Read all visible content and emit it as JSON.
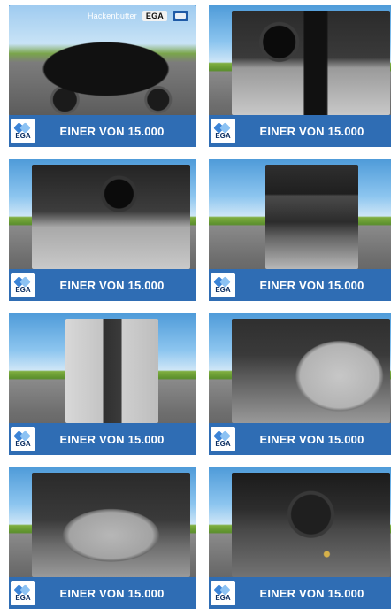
{
  "dealer": {
    "name": "Hackenbutter",
    "brand": "EGA"
  },
  "tiles": [
    {
      "caption": "EINER VON 15.000",
      "logo_text": "EGA",
      "photo": "exterior"
    },
    {
      "caption": "EINER VON 15.000",
      "logo_text": "EGA",
      "photo": "dashboard"
    },
    {
      "caption": "EINER VON 15.000",
      "logo_text": "EGA",
      "photo": "steering-side"
    },
    {
      "caption": "EINER VON 15.000",
      "logo_text": "EGA",
      "photo": "center-console"
    },
    {
      "caption": "EINER VON 15.000",
      "logo_text": "EGA",
      "photo": "door-panel"
    },
    {
      "caption": "EINER VON 15.000",
      "logo_text": "EGA",
      "photo": "front-seat"
    },
    {
      "caption": "EINER VON 15.000",
      "logo_text": "EGA",
      "photo": "rear-seat"
    },
    {
      "caption": "EINER VON 15.000",
      "logo_text": "EGA",
      "photo": "engine"
    }
  ],
  "colors": {
    "bar_blue": "#2f6db4",
    "logo_dark_blue": "#0c2f63",
    "logo_light_blue": "#8cc2f3",
    "logo_mid_blue": "#3b83d6"
  }
}
